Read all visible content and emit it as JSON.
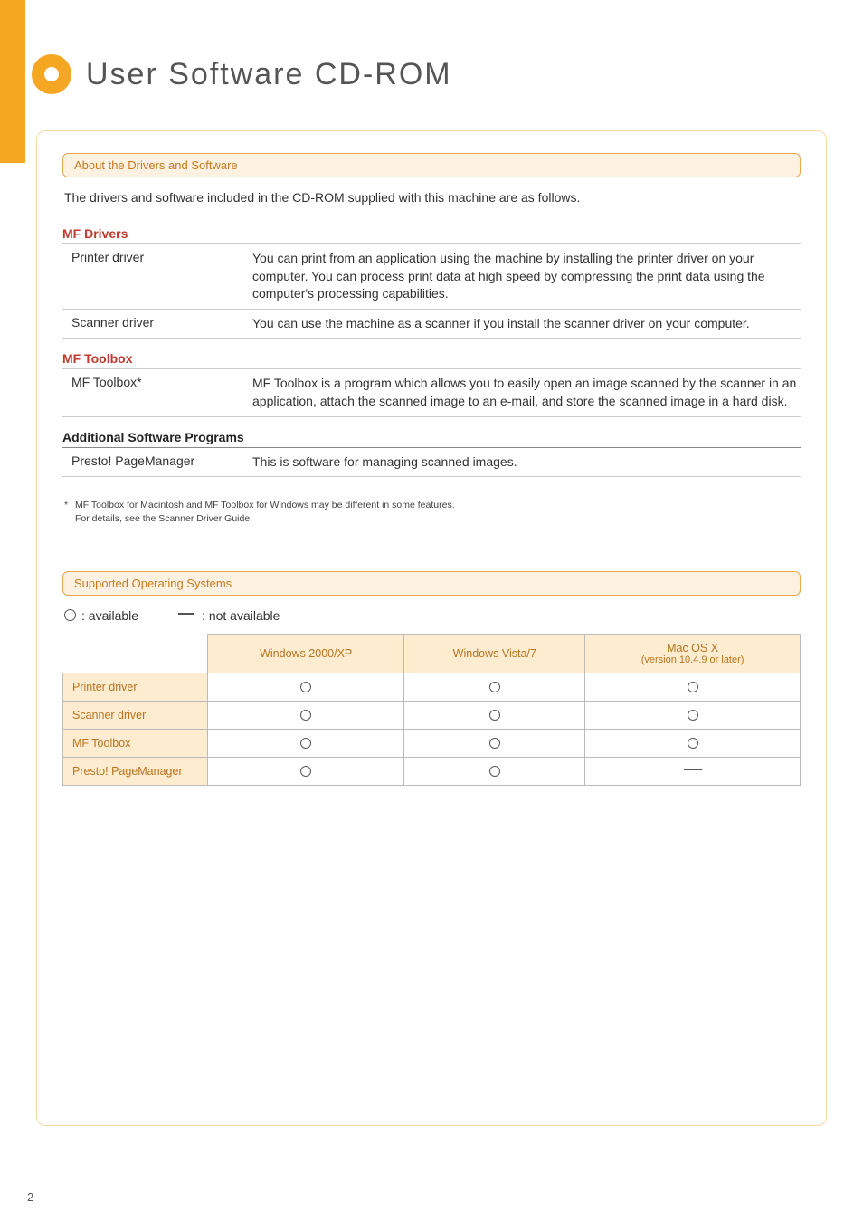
{
  "page_title": "User Software CD-ROM",
  "page_number": "2",
  "section1": {
    "header": "About the Drivers and Software",
    "intro": "The drivers and software included in the CD-ROM supplied with this machine are as follows.",
    "groups": [
      {
        "heading": "MF Drivers",
        "heading_style": "red",
        "rows": [
          {
            "key": "Printer driver",
            "val": "You can print from an application using the machine by installing the printer driver on your computer. You can process print data at high speed by compressing the print data using the computer's processing capabilities."
          },
          {
            "key": "Scanner driver",
            "val": "You can use the machine as a scanner if you install the scanner driver on your computer."
          }
        ]
      },
      {
        "heading": "MF Toolbox",
        "heading_style": "red",
        "rows": [
          {
            "key": "MF Toolbox*",
            "val": "MF Toolbox is a program which allows you to easily open an image scanned by the scanner in an application, attach the scanned image to an e-mail, and store the scanned image in a hard disk."
          }
        ]
      },
      {
        "heading": "Additional Software Programs",
        "heading_style": "black",
        "rows": [
          {
            "key": "Presto! PageManager",
            "val": "This is software for managing scanned images."
          }
        ]
      }
    ],
    "footnote_line1": "MF Toolbox for Macintosh and MF Toolbox for Windows may be different in some features.",
    "footnote_line2": "For details, see the Scanner Driver Guide."
  },
  "section2": {
    "header": "Supported Operating Systems",
    "legend_available": ": available",
    "legend_not_available": ": not available",
    "columns": [
      {
        "title": "Windows 2000/XP",
        "sub": ""
      },
      {
        "title": "Windows Vista/7",
        "sub": ""
      },
      {
        "title": "Mac OS X",
        "sub": "(version 10.4.9 or later)"
      }
    ],
    "rows": [
      {
        "label": "Printer driver",
        "cells": [
          "O",
          "O",
          "O"
        ]
      },
      {
        "label": "Scanner driver",
        "cells": [
          "O",
          "O",
          "O"
        ]
      },
      {
        "label": "MF Toolbox",
        "cells": [
          "O",
          "O",
          "O"
        ]
      },
      {
        "label": "Presto! PageManager",
        "cells": [
          "O",
          "O",
          "-"
        ]
      }
    ]
  },
  "chart_data": {
    "type": "table",
    "title": "Supported Operating Systems",
    "columns": [
      "Windows 2000/XP",
      "Windows Vista/7",
      "Mac OS X (version 10.4.9 or later)"
    ],
    "rows": [
      "Printer driver",
      "Scanner driver",
      "MF Toolbox",
      "Presto! PageManager"
    ],
    "legend": {
      "O": "available",
      "-": "not available"
    },
    "values": [
      [
        "O",
        "O",
        "O"
      ],
      [
        "O",
        "O",
        "O"
      ],
      [
        "O",
        "O",
        "O"
      ],
      [
        "O",
        "O",
        "-"
      ]
    ]
  }
}
